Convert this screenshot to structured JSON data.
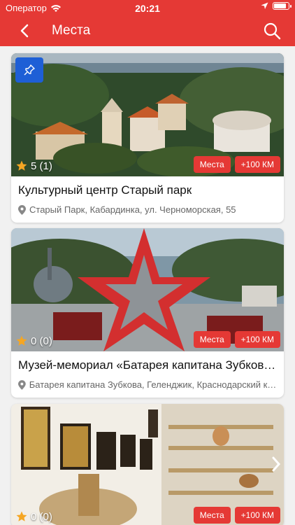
{
  "status_bar": {
    "carrier": "Оператор",
    "time": "20:21"
  },
  "header": {
    "title": "Места",
    "back_icon": "chevron-left-icon",
    "search_icon": "search-icon"
  },
  "colors": {
    "primary": "#e53935",
    "pin_badge": "#1e5fd6",
    "star": "#f5a623"
  },
  "places": [
    {
      "name": "Культурный центр Старый парк",
      "address": "Старый Парк, Кабардинка, ул. Черноморская, 55",
      "rating": "5 (1)",
      "tags": [
        "Места",
        "+100 КМ"
      ],
      "pinned": true
    },
    {
      "name": "Музей-мемориал «Батарея капитана Зубкова»",
      "address": "Батарея капитана Зубкова, Геленджик, Краснодарский край",
      "rating": "0 (0)",
      "tags": [
        "Места",
        "+100 КМ"
      ],
      "pinned": false
    },
    {
      "name": "",
      "address": "",
      "rating": "0 (0)",
      "tags": [
        "Места",
        "+100 КМ"
      ],
      "pinned": false
    }
  ]
}
